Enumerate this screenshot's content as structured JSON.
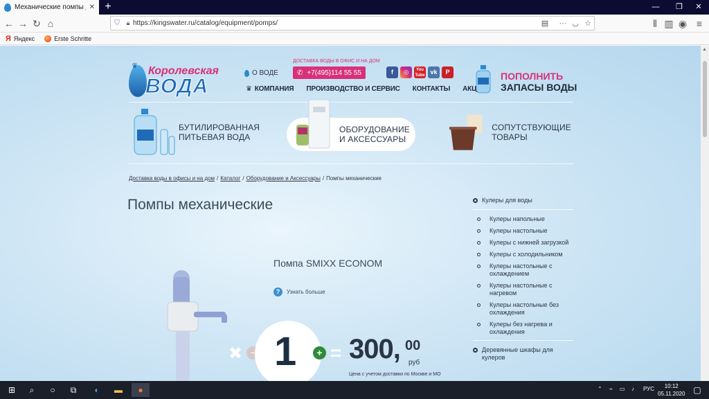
{
  "browser": {
    "tab_title": "Механические помпы для во",
    "url": "https://kingswater.ru/catalog/equipment/pomps/",
    "bookmarks": [
      {
        "label": "Яндекс"
      },
      {
        "label": "Erste Schritte"
      }
    ]
  },
  "header": {
    "logo_line1": "Королевская",
    "logo_line2": "ВОДА",
    "o_vode": "О ВОДЕ",
    "delivery_note": "ДОСТАВКА ВОДЫ В ОФИС И НА ДОМ",
    "phone": "+7(495)114 55 55",
    "socials": [
      "f",
      "ig",
      "You Tube",
      "vk",
      "P"
    ],
    "nav": [
      "КОМПАНИЯ",
      "ПРОИЗВОДСТВО И СЕРВИС",
      "КОНТАКТЫ",
      "АКЦИИ"
    ],
    "cta_line1": "ПОПОЛНИТЬ",
    "cta_line2": "ЗАПАСЫ ВОДЫ"
  },
  "categories": [
    {
      "line1": "БУТИЛИРОВАННАЯ",
      "line2": "ПИТЬЕВАЯ ВОДА"
    },
    {
      "line1": "ОБОРУДОВАНИЕ",
      "line2": "И АКСЕССУАРЫ"
    },
    {
      "line1": "СОПУТСТВУЮЩИЕ",
      "line2": "ТОВАРЫ"
    }
  ],
  "breadcrumb": {
    "items": [
      "Доставка воды в офисы и на дом",
      "Каталог",
      "Оборудование и Аксессуары"
    ],
    "separator": "/",
    "current": "Помпы механические"
  },
  "page_title": "Помпы механические",
  "product": {
    "name": "Помпа SMIXX ECONOM",
    "more_label": "Узнать больше",
    "quantity": "1",
    "price": "300,",
    "price_cents": "00",
    "currency": "руб",
    "price_note": "Цена с учетом доставки по Москве и МО"
  },
  "sidebar": {
    "top": "Кулеры для воды",
    "items": [
      "Кулеры напольные",
      "Кулеры настольные",
      "Кулеры с нижней загрузкой",
      "Кулеры с холодильником",
      "Кулеры настольные с охлаждением",
      "Кулеры настольные с нагревом",
      "Кулеры настольные без охлаждения",
      "Кулеры без нагрева и охлаждения"
    ],
    "last": "Деревянные шкафы для кулеров"
  },
  "taskbar": {
    "lang": "РУС",
    "time": "10:12",
    "date": "05.11.2020"
  },
  "colors": {
    "accent": "#d8317a",
    "brand_blue": "#1f6bb8",
    "plus_green": "#2f8a3a"
  }
}
